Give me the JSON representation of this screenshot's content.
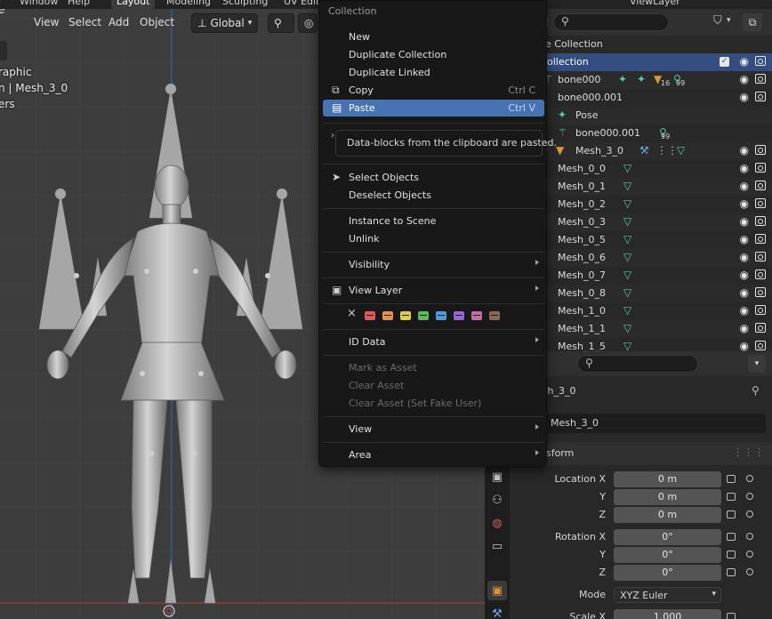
{
  "topbar": {
    "menu_window": "Window",
    "menu_help": "Help",
    "tabs": [
      "Layout",
      "Modeling",
      "Sculpting",
      "UV Editi"
    ],
    "active_tab": "Layout",
    "view_layer": "ViewLayer"
  },
  "viewport": {
    "menu": [
      "View",
      "Select",
      "Add",
      "Object"
    ],
    "orientation": "Global",
    "overlay_lines": [
      "raphic",
      "n | Mesh_3_0",
      "ers"
    ],
    "icons": [
      "eye-icon",
      "camera-icon"
    ]
  },
  "context_menu": {
    "title": "Collection",
    "items": [
      {
        "label": "New"
      },
      {
        "label": "Duplicate Collection"
      },
      {
        "label": "Duplicate Linked"
      },
      {
        "label": "Copy",
        "shortcut": "Ctrl C",
        "icon": "copy-icon"
      },
      {
        "label": "Paste",
        "shortcut": "Ctrl V",
        "icon": "paste-icon"
      },
      {
        "label": "Select Objects",
        "icon": "cursor-icon"
      },
      {
        "label": "Deselect Objects"
      },
      {
        "label": "Instance to Scene"
      },
      {
        "label": "Unlink"
      },
      {
        "label": "Visibility"
      },
      {
        "label": "View Layer",
        "icon": "render-layers-icon"
      },
      {
        "label": "ID Data"
      },
      {
        "label": "Mark as Asset"
      },
      {
        "label": "Clear Asset"
      },
      {
        "label": "Clear Asset (Set Fake User)"
      },
      {
        "label": "View"
      },
      {
        "label": "Area"
      }
    ],
    "close_glyph": "×",
    "tooltip": "Data-blocks from the clipboard are pasted.",
    "color_tags": [
      "#e05a5a",
      "#e0934a",
      "#e0cd4a",
      "#5dbb5d",
      "#4d9be0",
      "#9d64d6",
      "#c46fa6",
      "#8a6a52"
    ]
  },
  "outliner": {
    "rows": [
      {
        "label": "e Collection",
        "kind": "scene"
      },
      {
        "label": "ollection",
        "kind": "collection",
        "selected": true
      },
      {
        "label": "bone000",
        "kind": "armature",
        "badge1": "16",
        "badge2": "99"
      },
      {
        "label": "bone000.001",
        "kind": "object"
      },
      {
        "label": "Pose",
        "kind": "pose"
      },
      {
        "label": "bone000.001",
        "kind": "armature-data",
        "badge2": "99"
      },
      {
        "label": "Mesh_3_0",
        "kind": "mesh-object"
      },
      {
        "label": "Mesh_0_0",
        "kind": "mesh"
      },
      {
        "label": "Mesh_0_1",
        "kind": "mesh"
      },
      {
        "label": "Mesh_0_2",
        "kind": "mesh"
      },
      {
        "label": "Mesh_0_3",
        "kind": "mesh"
      },
      {
        "label": "Mesh_0_5",
        "kind": "mesh"
      },
      {
        "label": "Mesh_0_6",
        "kind": "mesh"
      },
      {
        "label": "Mesh_0_7",
        "kind": "mesh"
      },
      {
        "label": "Mesh_0_8",
        "kind": "mesh"
      },
      {
        "label": "Mesh_1_0",
        "kind": "mesh"
      },
      {
        "label": "Mesh_1_1",
        "kind": "mesh"
      },
      {
        "label": "Mesh_1_5",
        "kind": "mesh"
      }
    ]
  },
  "properties": {
    "object_name_header": "esh_3_0",
    "object_name_field": "Mesh_3_0",
    "panel_title": "nsform",
    "location_label": "Location X",
    "y_label": "Y",
    "z_label": "Z",
    "rotation_label": "Rotation X",
    "location": [
      "0 m",
      "0 m",
      "0 m"
    ],
    "rotation": [
      "0°",
      "0°",
      "0°"
    ],
    "mode_label": "Mode",
    "mode_value": "XYZ Euler",
    "scale_label": "Scale X",
    "scale_x": "1.000"
  }
}
